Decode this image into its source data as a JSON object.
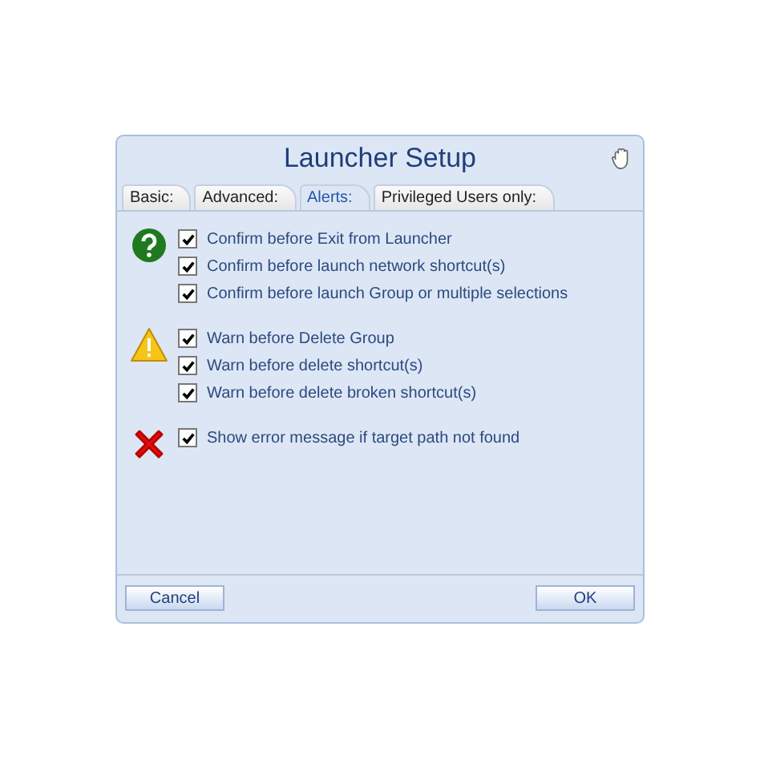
{
  "window": {
    "title": "Launcher Setup"
  },
  "tabs": [
    {
      "label": "Basic:",
      "selected": false
    },
    {
      "label": "Advanced:",
      "selected": false
    },
    {
      "label": "Alerts:",
      "selected": true
    },
    {
      "label": "Privileged Users only:",
      "selected": false
    }
  ],
  "groups": [
    {
      "kind": "question",
      "options": [
        {
          "label": "Confirm before Exit from Launcher",
          "checked": true
        },
        {
          "label": "Confirm before launch network shortcut(s)",
          "checked": true
        },
        {
          "label": "Confirm before launch Group or multiple selections",
          "checked": true
        }
      ]
    },
    {
      "kind": "warning",
      "options": [
        {
          "label": "Warn before Delete Group",
          "checked": true
        },
        {
          "label": "Warn before delete shortcut(s)",
          "checked": true
        },
        {
          "label": "Warn before delete broken shortcut(s)",
          "checked": true
        }
      ]
    },
    {
      "kind": "error",
      "options": [
        {
          "label": "Show error message if target path not found",
          "checked": true
        }
      ]
    }
  ],
  "buttons": [
    "Cancel",
    "OK"
  ]
}
